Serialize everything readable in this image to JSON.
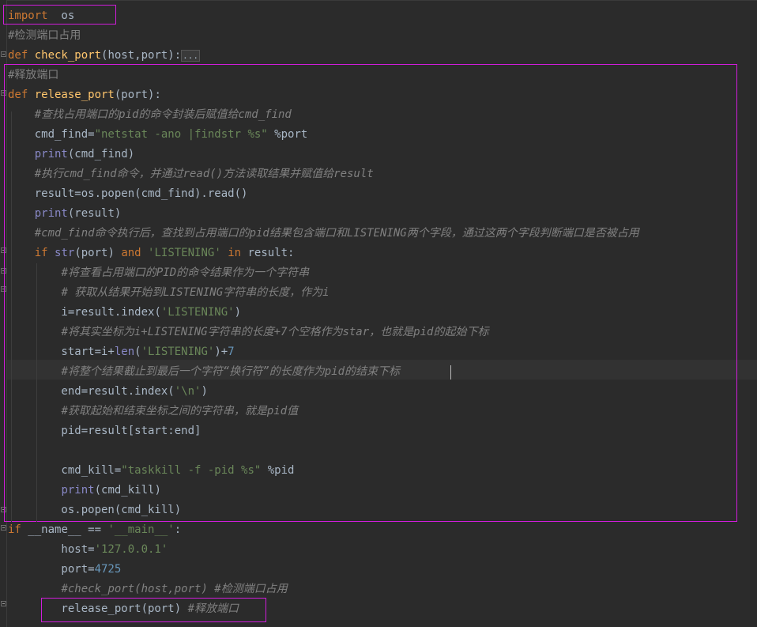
{
  "editor": {
    "lines": [
      {
        "id": "l1",
        "segments": [
          {
            "t": "import",
            "c": "kw"
          },
          {
            "t": "  os",
            "c": ""
          }
        ]
      },
      {
        "id": "l2",
        "segments": [
          {
            "t": "#检测端口占用",
            "c": "cmz"
          }
        ]
      },
      {
        "id": "l3",
        "segments": [
          {
            "t": "def ",
            "c": "kw"
          },
          {
            "t": "check_port",
            "c": "fn"
          },
          {
            "t": "(host,port):",
            "c": ""
          },
          {
            "t": "...",
            "c": "dots"
          }
        ]
      },
      {
        "id": "l4",
        "segments": [
          {
            "t": "#释放端口",
            "c": "cmz"
          }
        ]
      },
      {
        "id": "l5",
        "segments": [
          {
            "t": "def ",
            "c": "kw"
          },
          {
            "t": "release_port",
            "c": "fn"
          },
          {
            "t": "(port):",
            "c": ""
          }
        ]
      },
      {
        "id": "l6",
        "segments": [
          {
            "t": "    ",
            "c": ""
          },
          {
            "t": "#查找占用端口的pid的命令封装后赋值给cmd_find",
            "c": "cm"
          }
        ]
      },
      {
        "id": "l7",
        "segments": [
          {
            "t": "    cmd_find=",
            "c": ""
          },
          {
            "t": "\"netstat -ano |findstr %s\"",
            "c": "str"
          },
          {
            "t": " %",
            "c": ""
          },
          {
            "t": "port",
            "c": ""
          }
        ]
      },
      {
        "id": "l8",
        "segments": [
          {
            "t": "    ",
            "c": ""
          },
          {
            "t": "print",
            "c": "bi"
          },
          {
            "t": "(cmd_find)",
            "c": ""
          }
        ]
      },
      {
        "id": "l9",
        "segments": [
          {
            "t": "    ",
            "c": ""
          },
          {
            "t": "#执行cmd_find命令，并通过read()方法读取结果并赋值给result",
            "c": "cm"
          }
        ]
      },
      {
        "id": "l10",
        "segments": [
          {
            "t": "    result=os.popen(cmd_find).read()",
            "c": ""
          }
        ]
      },
      {
        "id": "l11",
        "segments": [
          {
            "t": "    ",
            "c": ""
          },
          {
            "t": "print",
            "c": "bi"
          },
          {
            "t": "(result)",
            "c": ""
          }
        ]
      },
      {
        "id": "l12",
        "segments": [
          {
            "t": "    ",
            "c": ""
          },
          {
            "t": "#cmd_find命令执行后，查找到占用端口的pid结果包含端口和LISTENING两个字段，通过这两个字段判断端口是否被占用",
            "c": "cm"
          }
        ]
      },
      {
        "id": "l13",
        "segments": [
          {
            "t": "    ",
            "c": ""
          },
          {
            "t": "if ",
            "c": "kw"
          },
          {
            "t": "str",
            "c": "bi"
          },
          {
            "t": "(port) ",
            "c": ""
          },
          {
            "t": "and ",
            "c": "kw"
          },
          {
            "t": "'LISTENING'",
            "c": "str"
          },
          {
            "t": " in ",
            "c": "kw"
          },
          {
            "t": "result:",
            "c": ""
          }
        ]
      },
      {
        "id": "l14",
        "segments": [
          {
            "t": "        ",
            "c": ""
          },
          {
            "t": "#将查看占用端口的PID的命令结果作为一个字符串",
            "c": "cm"
          }
        ]
      },
      {
        "id": "l15",
        "segments": [
          {
            "t": "        ",
            "c": ""
          },
          {
            "t": "# 获取从结果开始到LISTENING字符串的长度，作为i",
            "c": "cm"
          }
        ]
      },
      {
        "id": "l16",
        "segments": [
          {
            "t": "        i=result.index(",
            "c": ""
          },
          {
            "t": "'LISTENING'",
            "c": "str"
          },
          {
            "t": ")",
            "c": ""
          }
        ]
      },
      {
        "id": "l17",
        "segments": [
          {
            "t": "        ",
            "c": ""
          },
          {
            "t": "#将其实坐标为i+LISTENING字符串的长度+7个空格作为star，也就是pid的起始下标",
            "c": "cm"
          }
        ]
      },
      {
        "id": "l18",
        "segments": [
          {
            "t": "        start=i+",
            "c": ""
          },
          {
            "t": "len",
            "c": "bi"
          },
          {
            "t": "(",
            "c": ""
          },
          {
            "t": "'LISTENING'",
            "c": "str"
          },
          {
            "t": ")+",
            "c": ""
          },
          {
            "t": "7",
            "c": "num"
          }
        ]
      },
      {
        "id": "l19",
        "segments": [
          {
            "t": "        ",
            "c": ""
          },
          {
            "t": "#将整个结果截止到最后一个字符“换行符”的长度作为pid的结束下标",
            "c": "cm"
          }
        ]
      },
      {
        "id": "l20",
        "segments": [
          {
            "t": "        end=result.index(",
            "c": ""
          },
          {
            "t": "'\\n'",
            "c": "str"
          },
          {
            "t": ")",
            "c": ""
          }
        ]
      },
      {
        "id": "l21",
        "segments": [
          {
            "t": "        ",
            "c": ""
          },
          {
            "t": "#获取起始和结束坐标之间的字符串，就是pid值",
            "c": "cm"
          }
        ]
      },
      {
        "id": "l22",
        "segments": [
          {
            "t": "        pid=result[start:end]",
            "c": ""
          }
        ]
      },
      {
        "id": "l23",
        "segments": [
          {
            "t": "",
            "c": ""
          }
        ]
      },
      {
        "id": "l24",
        "segments": [
          {
            "t": "        cmd_kill=",
            "c": ""
          },
          {
            "t": "\"taskkill -f -pid %s\"",
            "c": "str"
          },
          {
            "t": " %",
            "c": ""
          },
          {
            "t": "pid",
            "c": ""
          }
        ]
      },
      {
        "id": "l25",
        "segments": [
          {
            "t": "        ",
            "c": ""
          },
          {
            "t": "print",
            "c": "bi"
          },
          {
            "t": "(cmd_kill)",
            "c": ""
          }
        ]
      },
      {
        "id": "l26",
        "segments": [
          {
            "t": "        os.popen(cmd_kill)",
            "c": ""
          }
        ]
      },
      {
        "id": "l27",
        "segments": [
          {
            "t": "if ",
            "c": "kw"
          },
          {
            "t": "__name__ == ",
            "c": ""
          },
          {
            "t": "'__main__'",
            "c": "str"
          },
          {
            "t": ":",
            "c": ""
          }
        ]
      },
      {
        "id": "l28",
        "segments": [
          {
            "t": "        host=",
            "c": ""
          },
          {
            "t": "'127.0.0.1'",
            "c": "str"
          }
        ]
      },
      {
        "id": "l29",
        "segments": [
          {
            "t": "        port=",
            "c": ""
          },
          {
            "t": "4725",
            "c": "num"
          }
        ]
      },
      {
        "id": "l30",
        "segments": [
          {
            "t": "        ",
            "c": ""
          },
          {
            "t": "#check_port(host,port) #检测端口占用",
            "c": "cm"
          }
        ]
      },
      {
        "id": "l31",
        "segments": [
          {
            "t": "        release_port(port) ",
            "c": ""
          },
          {
            "t": "#释放端口",
            "c": "cm"
          }
        ]
      }
    ]
  },
  "colors": {
    "background": "#2b2b2b",
    "keyword": "#cc7832",
    "function": "#ffc66d",
    "builtin": "#8888c6",
    "string": "#6a8759",
    "number": "#6897bb",
    "comment": "#808080",
    "highlight_box": "#d11ddb"
  }
}
